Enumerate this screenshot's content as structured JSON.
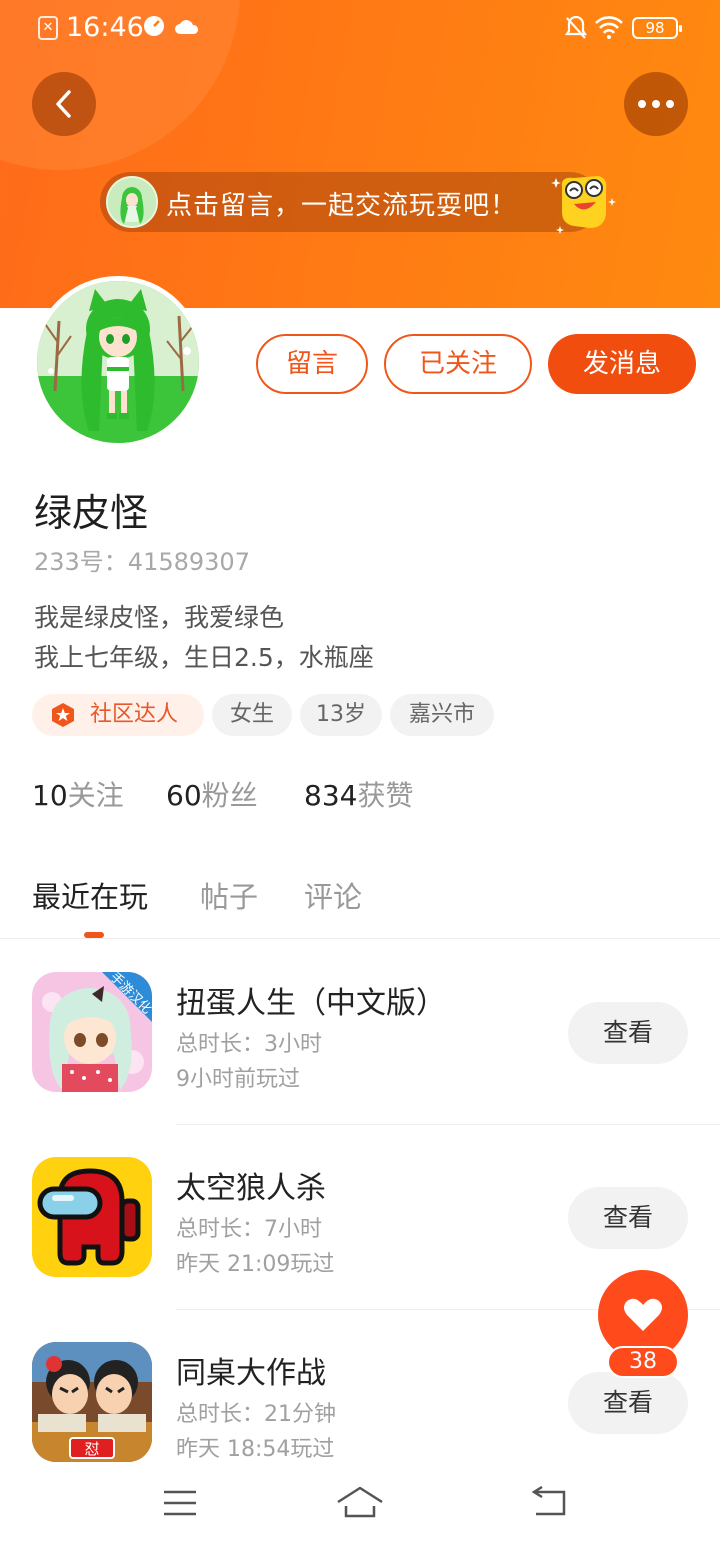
{
  "status_bar": {
    "time": "16:46",
    "battery": "98"
  },
  "header": {
    "banner_text": "点击留言，一起交流玩耍吧！"
  },
  "actions": {
    "message_board": "留言",
    "followed": "已关注",
    "send_message": "发消息"
  },
  "profile": {
    "name": "绿皮怪",
    "uid": "233号：41589307",
    "bio_line1": "我是绿皮怪，我爱绿色",
    "bio_line2": "我上七年级，生日2.5，水瓶座",
    "tags": [
      "社区达人",
      "女生",
      "13岁",
      "嘉兴市"
    ]
  },
  "stats": {
    "following_count": "10",
    "following_label": "关注",
    "fans_count": "60",
    "fans_label": "粉丝",
    "likes_count": "834",
    "likes_label": "获赞"
  },
  "tabs": [
    "最近在玩",
    "帖子",
    "评论"
  ],
  "games": [
    {
      "title": "扭蛋人生（中文版）",
      "duration": "总时长：3小时",
      "last_played": "9小时前玩过",
      "button": "查看",
      "icon_badge": "手游汉化"
    },
    {
      "title": "太空狼人杀",
      "duration": "总时长：7小时",
      "last_played": "昨天 21:09玩过",
      "button": "查看"
    },
    {
      "title": "同桌大作战",
      "duration": "总时长：21分钟",
      "last_played": "昨天 18:54玩过",
      "button": "查看",
      "icon_badge": "怼"
    }
  ],
  "like_fab": {
    "count": "38"
  },
  "colors": {
    "accent": "#f0561a",
    "header_orange": "#ff7a14"
  }
}
